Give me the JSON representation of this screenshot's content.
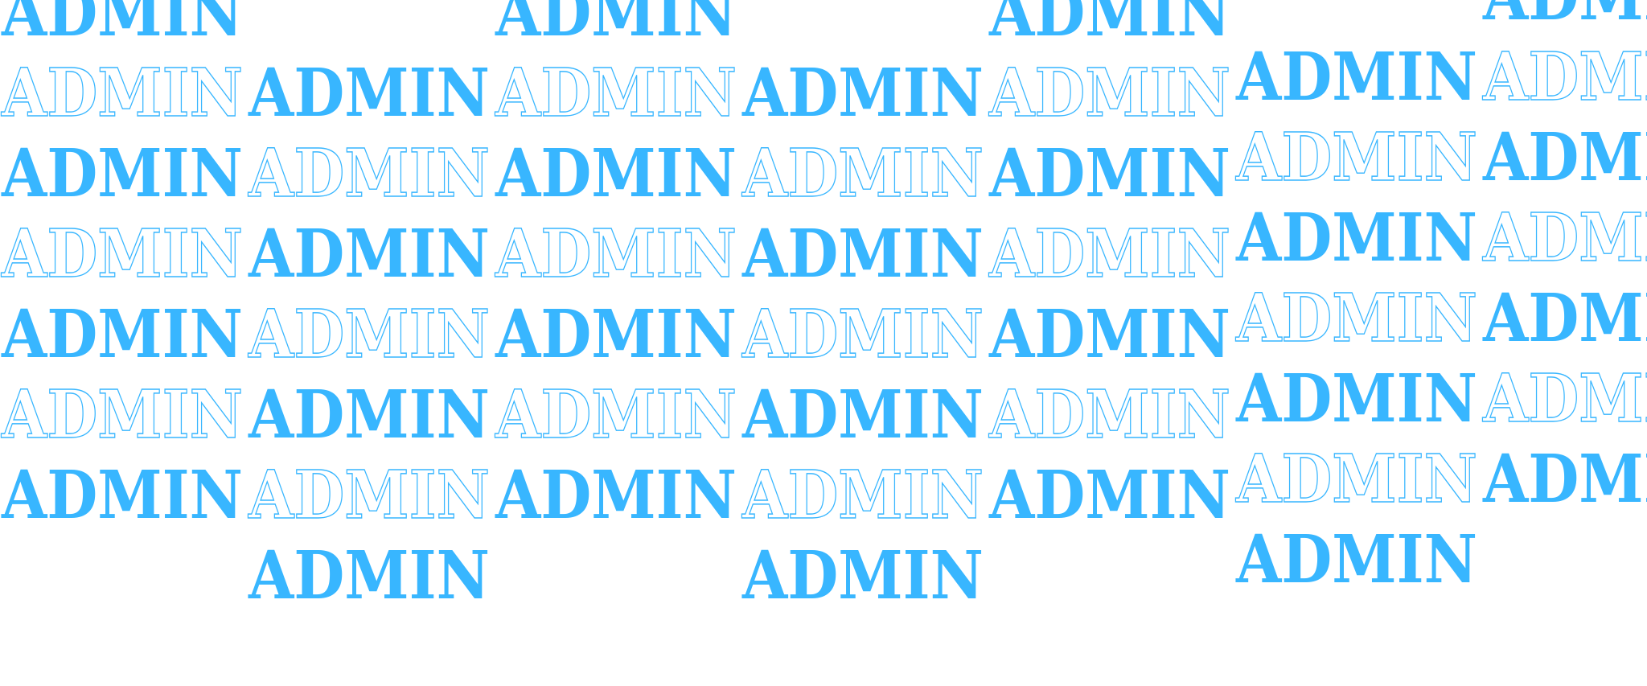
{
  "pattern": {
    "word": "ADMIN",
    "color": "#38b6ff",
    "background": "#ffffff",
    "styles": [
      "filled",
      "outline"
    ]
  }
}
